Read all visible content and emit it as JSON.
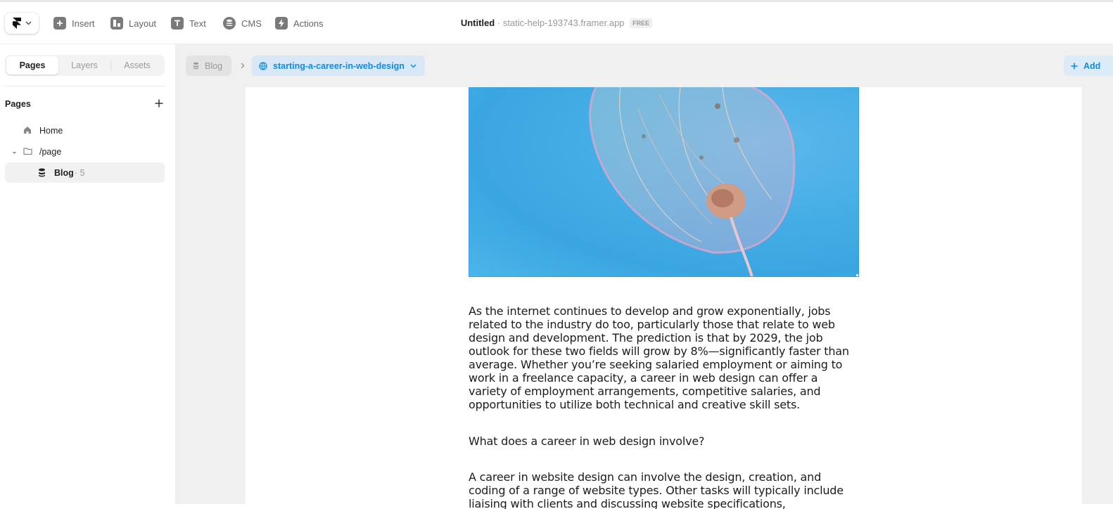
{
  "toolbar": {
    "insert_label": "Insert",
    "layout_label": "Layout",
    "text_label": "Text",
    "cms_label": "CMS",
    "actions_label": "Actions"
  },
  "document": {
    "title": "Untitled",
    "separator": "·",
    "domain": "static-help-193743.framer.app",
    "plan_badge": "FREE"
  },
  "sidebar": {
    "tabs": [
      {
        "label": "Pages",
        "active": true
      },
      {
        "label": "Layers",
        "active": false
      },
      {
        "label": "Assets",
        "active": false
      }
    ],
    "section_title": "Pages",
    "items": [
      {
        "label": "Home",
        "icon": "home-icon"
      },
      {
        "label": "/page",
        "icon": "folder-icon"
      },
      {
        "label": "Blog",
        "count": "· 5",
        "icon": "database-icon",
        "selected": true
      }
    ]
  },
  "canvas": {
    "breadcrumb_collection": "Blog",
    "breadcrumb_slug": "starting-a-career-in-web-design",
    "add_button_label": "Add"
  },
  "article": {
    "paragraph_1": "As the internet continues to develop and grow exponentially, jobs related to the industry do too, particularly those that relate to web design and development. The prediction is that by 2029, the job outlook for these two fields will grow by 8%—significantly faster than average. Whether you’re seeking salaried employment or aiming to work in a freelance capacity, a career in web design can offer a variety of employment arrangements, competitive salaries, and opportunities to utilize both technical and creative skill sets.",
    "heading_1": "What does a career in web design involve?",
    "paragraph_2": "A career in website design can involve the design, creation, and coding of a range of website types. Other tasks will typically include liaising with clients and discussing website specifications, incorporating feedback,"
  },
  "colors": {
    "accent": "#0b8ce9",
    "selection": "#3a9bf0",
    "canvas_bg": "#f0f0f0"
  }
}
